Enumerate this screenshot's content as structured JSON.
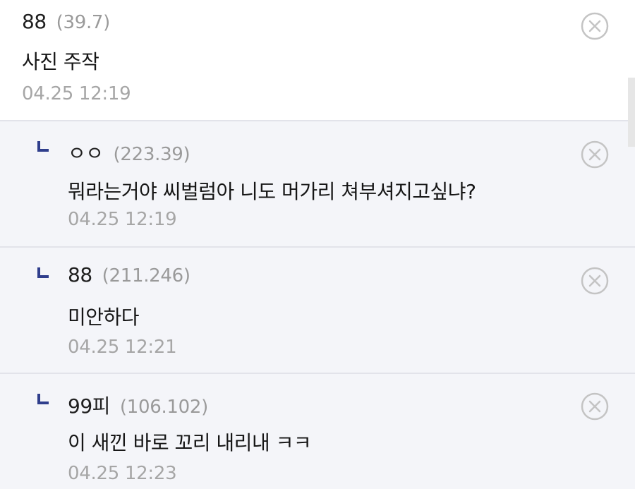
{
  "comments": [
    {
      "nickname": "88",
      "ip": "(39.7)",
      "text": "사진 주작",
      "time": "04.25 12:19"
    },
    {
      "nickname": "ㅇㅇ",
      "ip": "(223.39)",
      "text": "뭐라는거야 씨벌럼아 니도 머가리 쳐부셔지고싶냐?",
      "time": "04.25 12:19"
    },
    {
      "nickname": "88",
      "ip": "(211.246)",
      "text": "미안하다",
      "time": "04.25 12:21"
    },
    {
      "nickname": "99피",
      "ip": "(106.102)",
      "text": "이 새낀 바로 꼬리 내리내 ㅋㅋ",
      "time": "04.25 12:23"
    }
  ],
  "icons": {
    "delete": "close-circle-icon",
    "reply": "reply-corner-icon"
  },
  "colors": {
    "reply_background": "#f4f5f9",
    "reply_icon": "#2f3e8c",
    "divider": "#e2e3ea",
    "meta_text": "#9a9a9a",
    "icon_gray": "#c4c4c4"
  }
}
